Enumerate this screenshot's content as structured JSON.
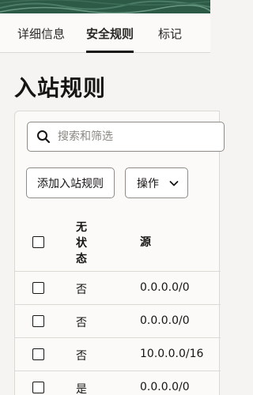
{
  "tabs": [
    {
      "label": "详细信息",
      "active": false
    },
    {
      "label": "安全规则",
      "active": true
    },
    {
      "label": "标记",
      "active": false
    }
  ],
  "page": {
    "title": "入站规则"
  },
  "search": {
    "placeholder": "搜索和筛选",
    "icon": "search-icon"
  },
  "toolbar": {
    "add_label": "添加入站规则",
    "actions_label": "操作",
    "actions_icon": "chevron-down-icon"
  },
  "table": {
    "headers": {
      "stateless": "无状态",
      "source": "源"
    },
    "rows": [
      {
        "stateless": "否",
        "source": "0.0.0.0/0"
      },
      {
        "stateless": "否",
        "source": "0.0.0.0/0"
      },
      {
        "stateless": "否",
        "source": "10.0.0.0/16"
      },
      {
        "stateless": "是",
        "source": "0.0.0.0/0"
      }
    ]
  },
  "colors": {
    "banner": "#2d5a47",
    "background": "#f5f4f2",
    "text": "#161513",
    "border": "#dcd9d4"
  }
}
